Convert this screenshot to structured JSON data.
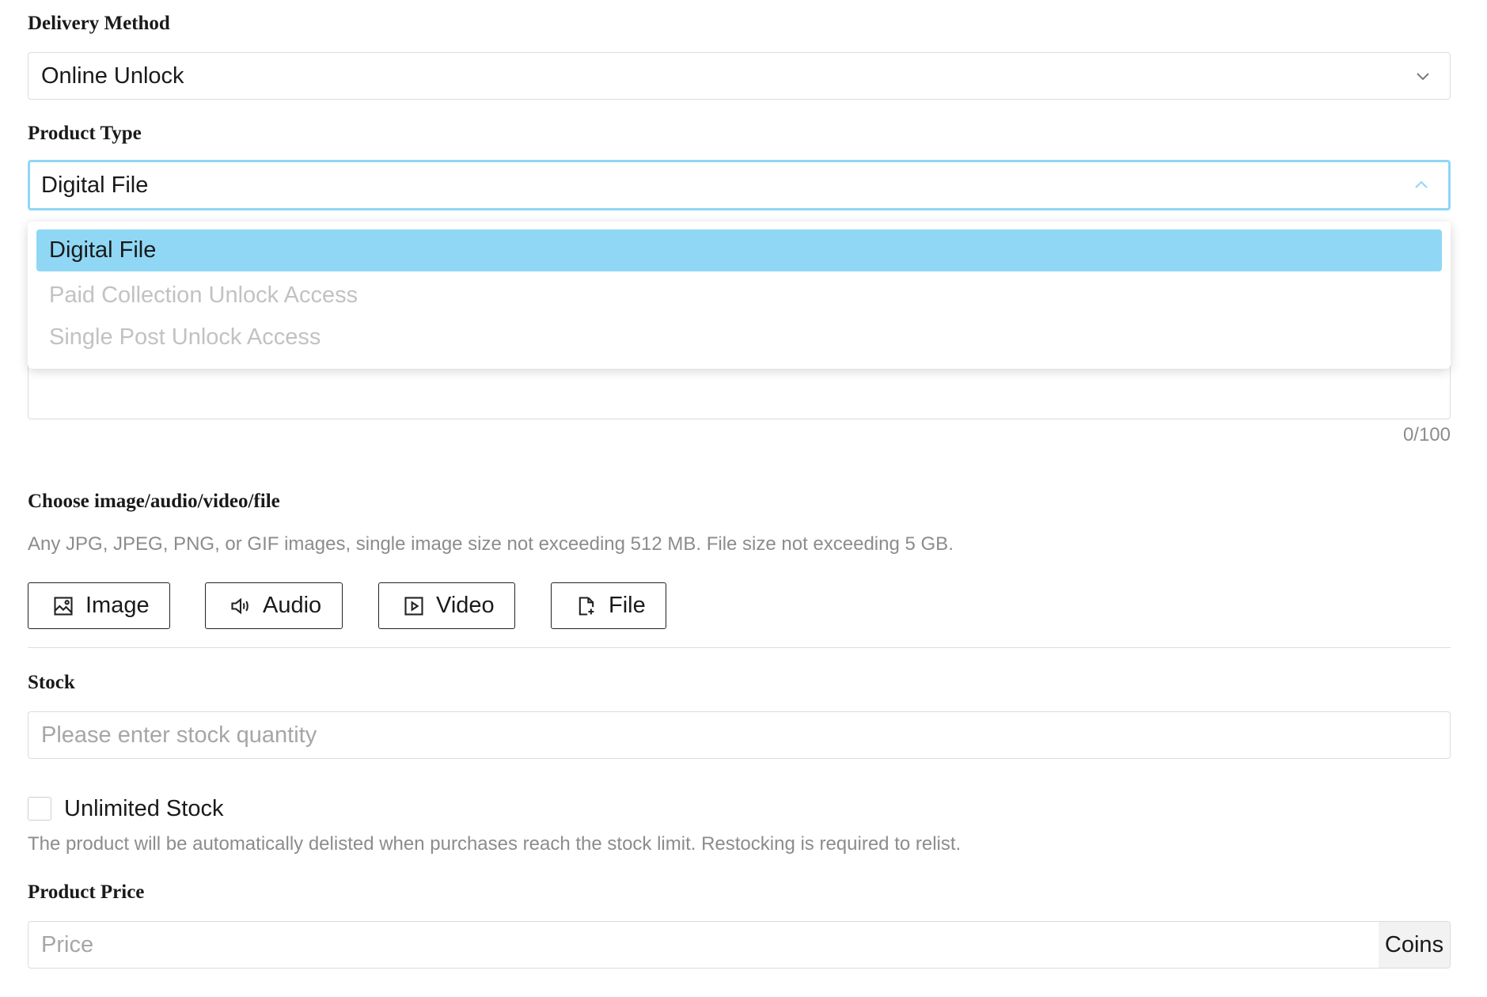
{
  "delivery": {
    "label": "Delivery Method",
    "value": "Online Unlock"
  },
  "product_type": {
    "label": "Product Type",
    "value": "Digital File",
    "options": [
      "Digital File",
      "Paid Collection Unlock Access",
      "Single Post Unlock Access"
    ]
  },
  "description": {
    "counter": "0/100"
  },
  "media": {
    "label": "Choose image/audio/video/file",
    "hint": "Any JPG, JPEG, PNG, or GIF images, single image size not exceeding 512 MB. File size not exceeding 5 GB.",
    "buttons": {
      "image": "Image",
      "audio": "Audio",
      "video": "Video",
      "file": "File"
    }
  },
  "stock": {
    "label": "Stock",
    "placeholder": "Please enter stock quantity",
    "unlimited_label": "Unlimited Stock",
    "note": "The product will be automatically delisted when purchases reach the stock limit. Restocking is required to relist."
  },
  "price": {
    "label": "Product Price",
    "placeholder": "Price",
    "suffix": "Coins"
  },
  "colors": {
    "accent": "#8fd7f5"
  }
}
